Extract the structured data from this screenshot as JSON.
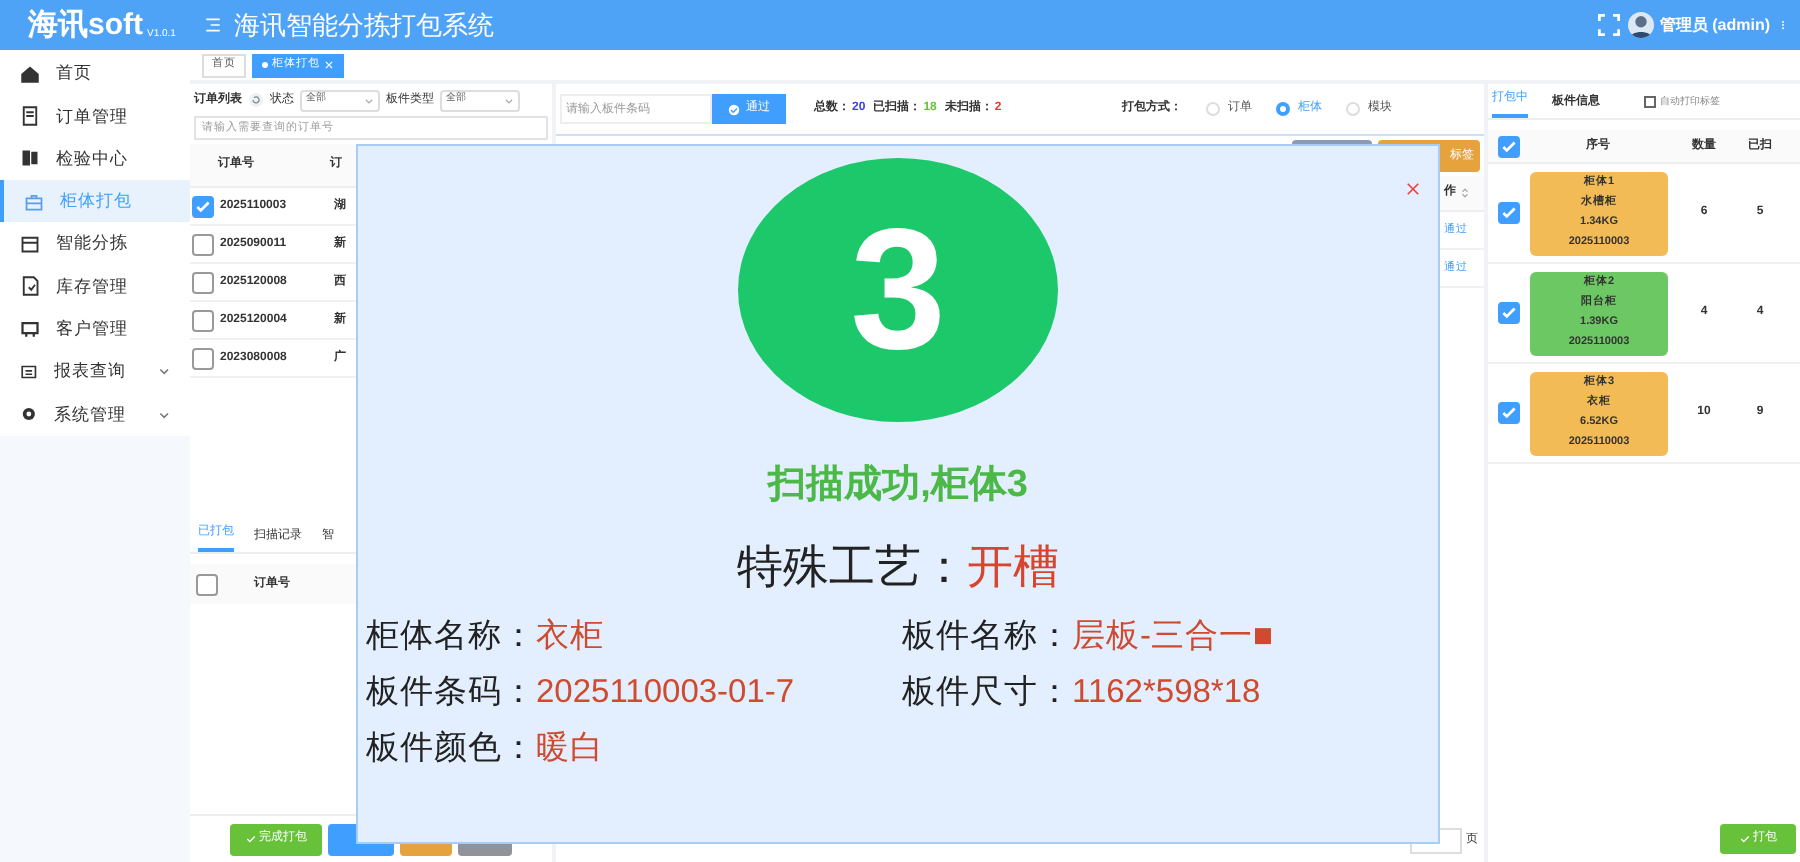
{
  "header": {
    "logo": "海讯soft",
    "version": "V1.0.1",
    "title": "海讯智能分拣打包系统",
    "user": "管理员 (admin)"
  },
  "sidebar": {
    "items": [
      {
        "label": "首页",
        "selected": false
      },
      {
        "label": "订单管理",
        "selected": false
      },
      {
        "label": "检验中心",
        "selected": false
      },
      {
        "label": "柜体打包",
        "selected": true
      },
      {
        "label": "智能分拣",
        "selected": false
      },
      {
        "label": "库存管理",
        "selected": false
      },
      {
        "label": "客户管理",
        "selected": false
      },
      {
        "label": "报表查询",
        "selected": false,
        "expandable": true
      },
      {
        "label": "系统管理",
        "selected": false,
        "expandable": true
      }
    ]
  },
  "tabs": [
    {
      "label": "首页",
      "selected": false
    },
    {
      "label": "柜体打包",
      "selected": true,
      "closable": true
    }
  ],
  "order_panel": {
    "title": "订单列表",
    "filters": [
      {
        "label": "状态",
        "value": "全部"
      },
      {
        "label": "板件类型",
        "value": "全部"
      }
    ],
    "search": {
      "placeholder": "请输入需要查询的订单号"
    },
    "table": {
      "columns": [
        "订单号",
        "订"
      ],
      "rows": [
        {
          "order": "2025110003",
          "column_2": "湖",
          "checked": true
        },
        {
          "order": "2025090011",
          "column_2": "新",
          "checked": false
        },
        {
          "order": "2025120008",
          "column_2": "西",
          "checked": false
        },
        {
          "order": "2025120004",
          "column_2": "新",
          "checked": false
        },
        {
          "order": "2023080008",
          "column_2": "广",
          "checked": false
        }
      ]
    },
    "lower_tabs": [
      {
        "label": "已打包",
        "selected": true
      },
      {
        "label": "扫描记录",
        "selected": false
      },
      {
        "label": "智",
        "selected": false
      }
    ],
    "lower_table": {
      "columns": [
        "订单号"
      ],
      "all_checked": false
    },
    "footer_button": "完成打包"
  },
  "scan_panel": {
    "barcode": {
      "placeholder": "请输入板件条码"
    },
    "pass_button": "通过",
    "stats": [
      {
        "label": "总数：",
        "value": "20",
        "color": "#3b3bf0"
      },
      {
        "label": "已扫描：",
        "value": "18",
        "color": "#67c23a"
      },
      {
        "label": "未扫描：",
        "value": "2",
        "color": "#f03030"
      }
    ],
    "pack_mode": {
      "label": "打包方式：",
      "options": [
        {
          "label": "订单",
          "selected": false
        },
        {
          "label": "柜体",
          "selected": true
        },
        {
          "label": "模块",
          "selected": false
        }
      ]
    },
    "label_button": "标签",
    "table": {
      "column": "作",
      "rows": [
        {
          "action": "通过"
        },
        {
          "action": "通过"
        }
      ]
    },
    "pagination": {
      "suffix": "页"
    }
  },
  "pack_panel": {
    "tabs": [
      {
        "label": "打包中",
        "selected": true
      },
      {
        "label": "板件信息",
        "selected": false
      }
    ],
    "auto_print": {
      "label": "自动打印标签",
      "checked": false
    },
    "columns": [
      "序号",
      "数量",
      "已扫"
    ],
    "all_checked": true,
    "rows": [
      {
        "title": "柜体1",
        "name": "水槽柜",
        "weight": "1.34KG",
        "order": "2025110003",
        "quantity": "6",
        "scanned": "5",
        "checked": true,
        "color": "#f2bb55"
      },
      {
        "title": "柜体2",
        "name": "阳台柜",
        "weight": "1.39KG",
        "order": "2025110003",
        "quantity": "4",
        "scanned": "4",
        "checked": true,
        "color": "#6cc863"
      },
      {
        "title": "柜体3",
        "name": "衣柜",
        "weight": "6.52KG",
        "order": "2025110003",
        "quantity": "10",
        "scanned": "9",
        "checked": true,
        "color": "#f2bb55"
      }
    ],
    "pack_button": "打包"
  },
  "modal": {
    "number": "3",
    "message": "扫描成功,柜体3",
    "special": {
      "label": "特殊工艺：",
      "value": "开槽"
    },
    "fields": [
      {
        "label": "柜体名称：",
        "value": "衣柜"
      },
      {
        "label": "板件名称：",
        "value": "层板-三合一■"
      },
      {
        "label": "板件条码：",
        "value": "2025110003-01-7"
      },
      {
        "label": "板件尺寸：",
        "value": "1162*598*18"
      },
      {
        "label": "板件颜色：",
        "value": "暖白"
      }
    ]
  }
}
